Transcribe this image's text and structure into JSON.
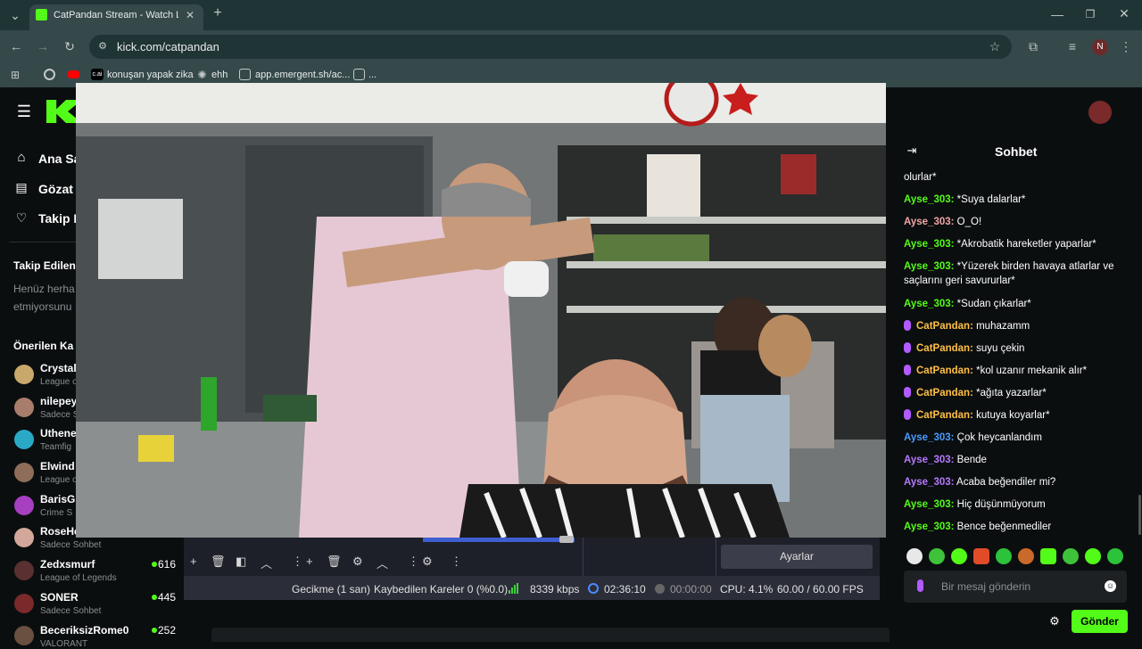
{
  "browser": {
    "tab_title": "CatPandan Stream - Watch Live",
    "url": "kick.com/catpandan",
    "bookmarks": [
      "konuşan yapak zika",
      "ehh",
      "app.emergent.sh/ac...",
      "..."
    ],
    "profile_initial": "N"
  },
  "sidebar": {
    "nav": [
      "Ana Sa",
      "Gözat",
      "Takip E"
    ],
    "following_title": "Takip Edilen",
    "following_empty": [
      "Henüz herha",
      "etmiyorsunu"
    ],
    "recommended_title": "Önerilen Ka",
    "recommended": [
      {
        "name": "Crystal",
        "category": "League o",
        "color": "#c9a86b"
      },
      {
        "name": "nilepey",
        "category": "Sadece S",
        "color": "#a87d6c"
      },
      {
        "name": "Uthene",
        "category": "Teamfig",
        "color": "#2aa9c6"
      },
      {
        "name": "Elwind",
        "category": "League o",
        "color": "#8e6e5a"
      },
      {
        "name": "BarisG",
        "category": "Crime S",
        "color": "#a63fc0"
      },
      {
        "name": "RoseHe",
        "category": "Sadece Sohbet",
        "color": "#d3a79a"
      },
      {
        "name": "Zedxsmurf",
        "category": "League of Legends",
        "viewers": "616",
        "color": "#5a3030"
      },
      {
        "name": "SONER",
        "category": "Sadece Sohbet",
        "viewers": "445",
        "color": "#7a2a2a"
      },
      {
        "name": "BeceriksizRome0",
        "category": "VALORANT",
        "viewers": "252",
        "color": "#6a5040"
      }
    ]
  },
  "obs": {
    "settings_label": "Ayarlar",
    "delay": "Gecikme (1 san)",
    "dropped": "Kaybedilen Kareler 0 (%0.0)",
    "bitrate": "8339 kbps",
    "live_time": "02:36:10",
    "rec_time": "00:00:00",
    "cpu": "CPU: 4.1%",
    "fps": "60.00 / 60.00 FPS"
  },
  "chat": {
    "title": "Sohbet",
    "messages": [
      {
        "user": "",
        "text": "olurlar*",
        "color": ""
      },
      {
        "user": "Ayse_303:",
        "text": " *Suya dalarlar*",
        "color": "green"
      },
      {
        "user": "Ayse_303:",
        "text": " O_O!",
        "color": "pink"
      },
      {
        "user": "Ayse_303:",
        "text": " *Akrobatik hareketler yaparlar*",
        "color": "green"
      },
      {
        "user": "Ayse_303:",
        "text": " *Yüzerek birden havaya atlarlar ve saçlarını geri savururlar*",
        "color": "green"
      },
      {
        "user": "Ayse_303:",
        "text": " *Sudan çıkarlar*",
        "color": "green"
      },
      {
        "user": "CatPandan:",
        "text": " muhazamm",
        "color": "orange",
        "mic": true
      },
      {
        "user": "CatPandan:",
        "text": " suyu çekin",
        "color": "orange",
        "mic": true
      },
      {
        "user": "CatPandan:",
        "text": " *kol uzanır mekanik alır*",
        "color": "orange",
        "mic": true
      },
      {
        "user": "CatPandan:",
        "text": " *ağıta yazarlar*",
        "color": "orange",
        "mic": true
      },
      {
        "user": "CatPandan:",
        "text": " kutuya koyarlar*",
        "color": "orange",
        "mic": true
      },
      {
        "user": "Ayse_303:",
        "text": " Çok heycanlandım",
        "color": "blue"
      },
      {
        "user": "Ayse_303:",
        "text": " Bende",
        "color": "purple"
      },
      {
        "user": "Ayse_303:",
        "text": " Acaba beğendiler mi?",
        "color": "purple"
      },
      {
        "user": "Ayse_303:",
        "text": " Hiç düşünmüyorum",
        "color": "green"
      },
      {
        "user": "Ayse_303:",
        "text": " Bence beğenmediler",
        "color": "green"
      }
    ],
    "input_placeholder": "Bir mesaj gönderin",
    "send_label": "Gönder"
  },
  "colors": {
    "accent": "#53fc18",
    "chrome_dark": "#1f3435",
    "chrome": "#35494a"
  }
}
